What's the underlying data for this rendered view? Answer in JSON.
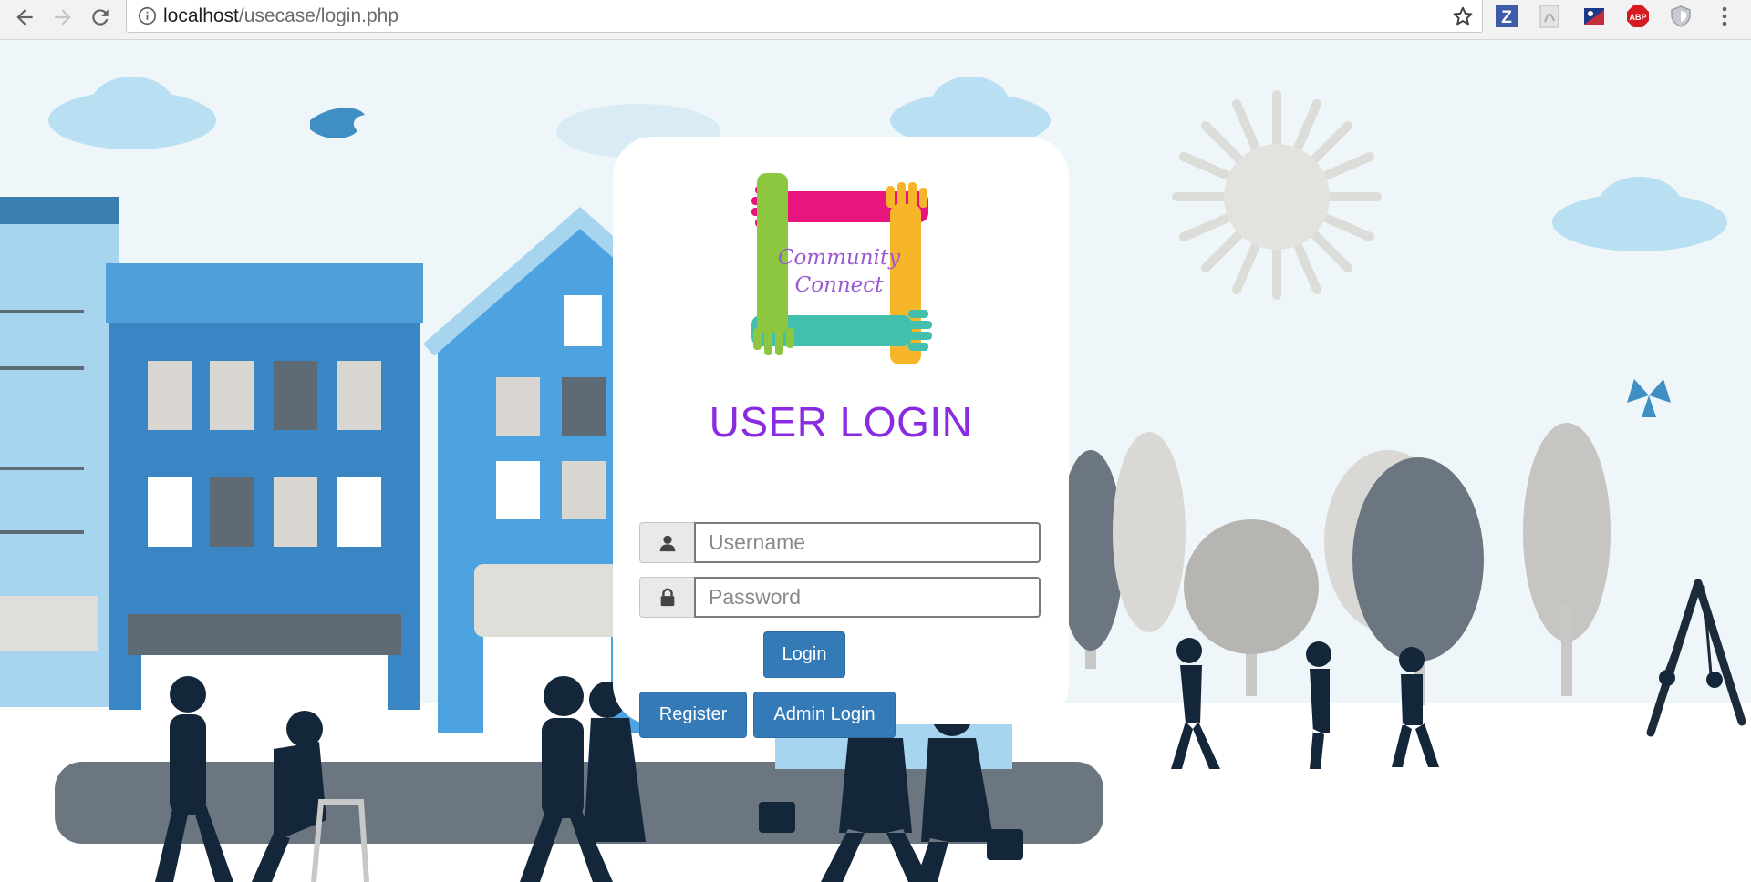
{
  "browser": {
    "url_host": "localhost",
    "url_path": "/usecase/login.php",
    "nav_icons": [
      "back-icon",
      "forward-icon",
      "reload-icon"
    ],
    "extensions": [
      {
        "name": "zotero-extension-icon",
        "label": "Z",
        "color": "#3c5ba8"
      },
      {
        "name": "pdf-extension-icon",
        "label": "",
        "color": "#b0b0b0"
      },
      {
        "name": "flag-extension-icon",
        "label": "",
        "color": "#1d3a8a"
      },
      {
        "name": "adblock-plus-icon",
        "label": "ABP",
        "color": "#d51b21"
      },
      {
        "name": "shield-extension-icon",
        "label": "",
        "color": "#9aa0a6"
      },
      {
        "name": "menu-icon",
        "label": "",
        "color": "#5f6368"
      }
    ]
  },
  "login": {
    "logo_text_line1": "Community",
    "logo_text_line2": "Connect",
    "title": "USER LOGIN",
    "username_placeholder": "Username",
    "password_placeholder": "Password",
    "login_button": "Login",
    "register_button": "Register",
    "admin_login_button": "Admin Login"
  },
  "colors": {
    "title": "#8a2be2",
    "button": "#337ab7",
    "background": "#eff6f9"
  }
}
